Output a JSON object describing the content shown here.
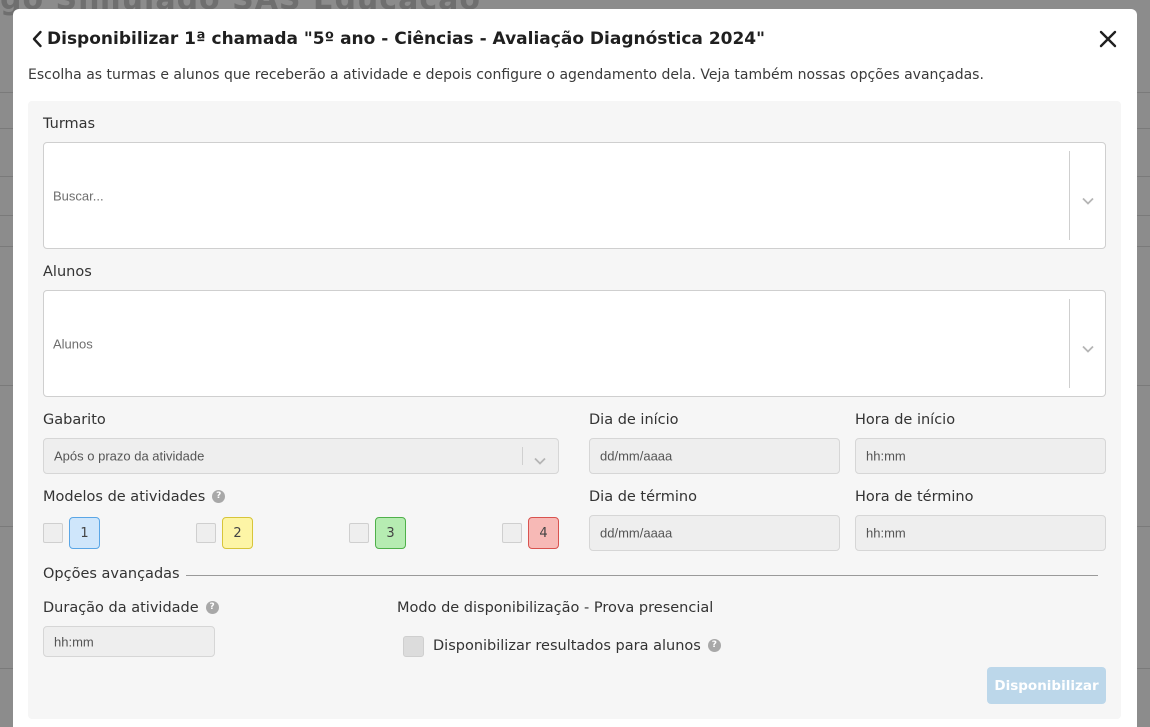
{
  "background": {
    "title": "gõ Simulado SAS Educação"
  },
  "modal": {
    "title": "Disponibilizar 1ª chamada \"5º ano - Ciências - Avaliação Diagnóstica 2024\"",
    "subtitle": "Escolha as turmas e alunos que receberão a atividade e depois configure o agendamento dela. Veja também nossas opções avançadas.",
    "icons": {
      "back": "chevron-left-icon",
      "close": "close-icon"
    }
  },
  "form": {
    "turmas": {
      "label": "Turmas",
      "placeholder": "Buscar..."
    },
    "alunos": {
      "label": "Alunos",
      "placeholder": "Alunos"
    },
    "gabarito": {
      "label": "Gabarito",
      "value": "Após o prazo da atividade"
    },
    "dia_inicio": {
      "label": "Dia de início",
      "placeholder": "dd/mm/aaaa"
    },
    "hora_inicio": {
      "label": "Hora de início",
      "placeholder": "hh:mm"
    },
    "modelos": {
      "label": "Modelos de atividades",
      "items": [
        {
          "label": "1",
          "bg": "#cfe6fb",
          "border": "#5aa6e6"
        },
        {
          "label": "2",
          "bg": "#fdf5a6",
          "border": "#d7c53a"
        },
        {
          "label": "3",
          "bg": "#b6ecb2",
          "border": "#4fb04a"
        },
        {
          "label": "4",
          "bg": "#f7b9b6",
          "border": "#d9534f"
        }
      ]
    },
    "dia_termino": {
      "label": "Dia de término",
      "placeholder": "dd/mm/aaaa"
    },
    "hora_termino": {
      "label": "Hora de término",
      "placeholder": "hh:mm"
    },
    "opcoes_avancadas": {
      "label": "Opções avançadas"
    },
    "duracao": {
      "label": "Duração da atividade",
      "placeholder": "hh:mm"
    },
    "modo": {
      "label": "Modo de disponibilização - Prova presencial"
    },
    "resultados": {
      "label": "Disponibilizar resultados para alunos"
    },
    "submit": {
      "label": "Disponibilizar"
    }
  },
  "colors": {
    "submit_disabled": "#bcd7ea",
    "help_icon": "#a8a8a8",
    "panel": "#f6f6f6"
  }
}
